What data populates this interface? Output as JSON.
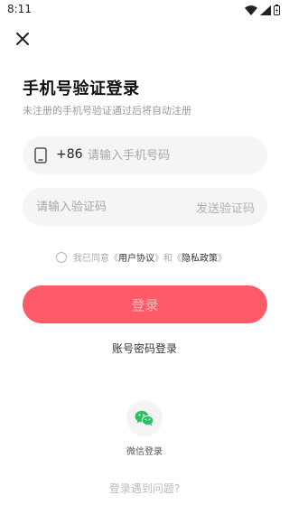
{
  "status_bar": {
    "time": "8:11"
  },
  "header": {
    "title": "手机号验证登录",
    "subtitle": "未注册的手机号验证通过后将自动注册"
  },
  "phone_field": {
    "country_code": "+86",
    "placeholder": "请输入手机号码"
  },
  "code_field": {
    "placeholder": "请输入验证码",
    "send_label": "发送验证码"
  },
  "agreement": {
    "prefix": "我已同意《",
    "user_agreement": "用户协议",
    "middle": "》和《",
    "privacy_policy": "隐私政策",
    "suffix": "》"
  },
  "login_button": {
    "label": "登录"
  },
  "password_login": {
    "label": "账号密码登录"
  },
  "wechat": {
    "label": "微信登录"
  },
  "help": {
    "label": "登录遇到问题?"
  },
  "colors": {
    "accent": "#ff5a68",
    "wechat": "#2cc160"
  }
}
